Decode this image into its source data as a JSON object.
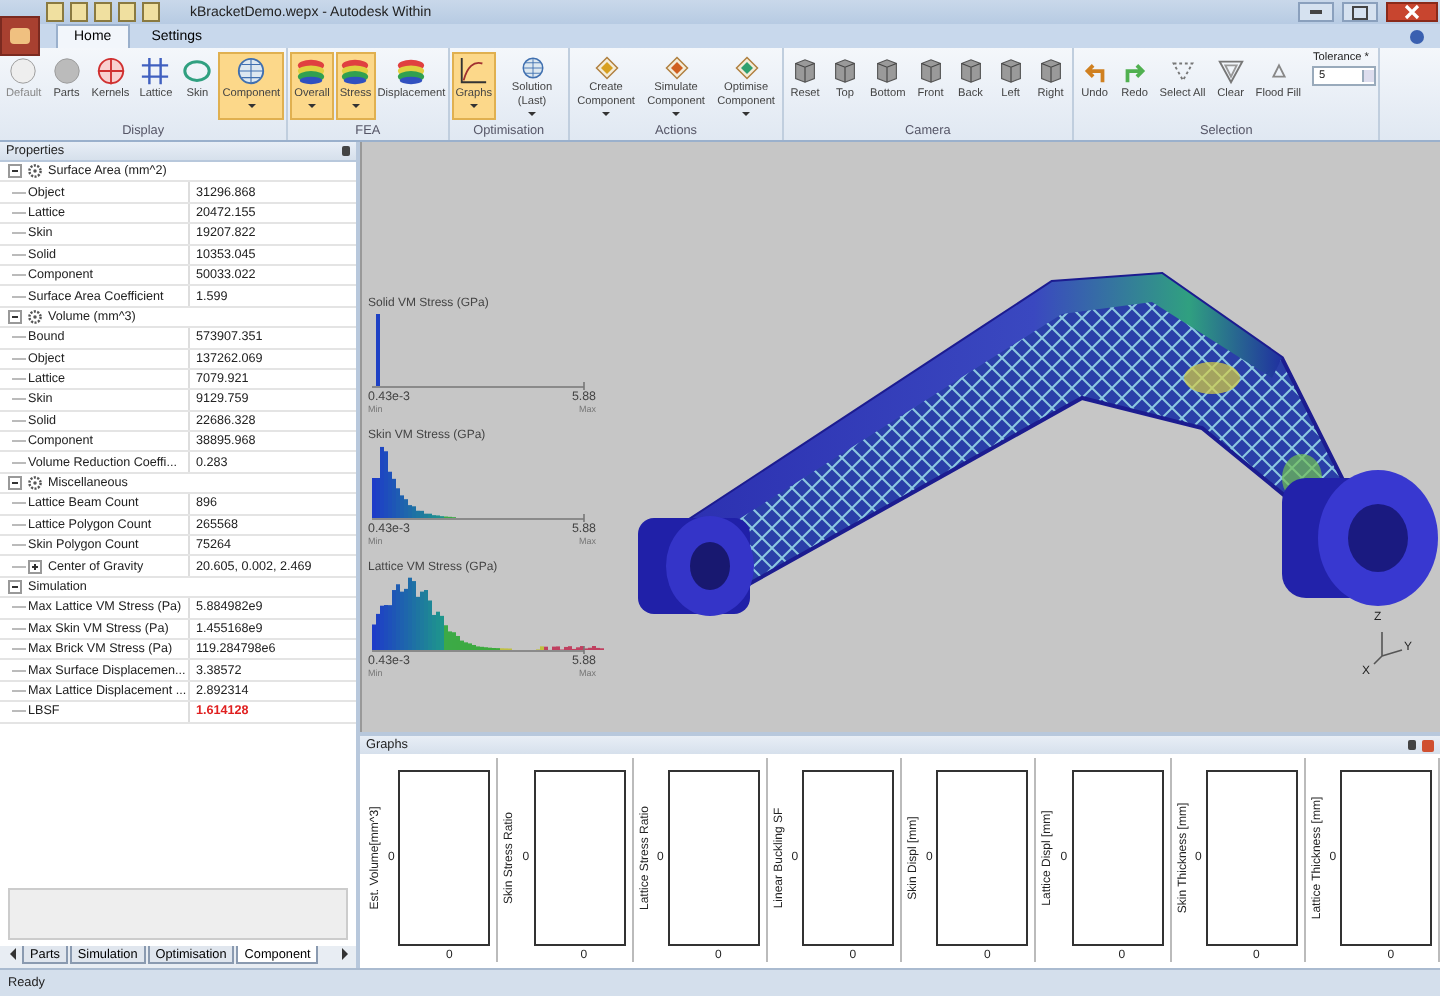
{
  "window": {
    "title": "kBracketDemo.wepx - Autodesk Within"
  },
  "tabs": [
    {
      "label": "Home",
      "selected": true
    },
    {
      "label": "Settings",
      "selected": false
    }
  ],
  "ribbon": {
    "groups": [
      {
        "label": "Display",
        "buttons": [
          {
            "label": "Default",
            "selected": false,
            "disabled": true,
            "dropdown": false
          },
          {
            "label": "Parts",
            "selected": false,
            "disabled": false,
            "dropdown": false
          },
          {
            "label": "Kernels",
            "selected": false,
            "disabled": false,
            "dropdown": false
          },
          {
            "label": "Lattice",
            "selected": false,
            "disabled": false,
            "dropdown": false
          },
          {
            "label": "Skin",
            "selected": false,
            "disabled": false,
            "dropdown": false
          },
          {
            "label": "Component",
            "selected": true,
            "disabled": false,
            "dropdown": true
          }
        ]
      },
      {
        "label": "FEA",
        "buttons": [
          {
            "label": "Overall",
            "selected": true,
            "disabled": false,
            "dropdown": true
          },
          {
            "label": "Stress",
            "selected": true,
            "disabled": false,
            "dropdown": true
          },
          {
            "label": "Displacement",
            "selected": false,
            "disabled": false,
            "dropdown": false
          }
        ]
      },
      {
        "label": "Optimisation",
        "buttons": [
          {
            "label": "Graphs",
            "selected": true,
            "disabled": false,
            "dropdown": true
          },
          {
            "label": "Solution (Last)",
            "selected": false,
            "disabled": false,
            "dropdown": true
          }
        ]
      },
      {
        "label": "Actions",
        "buttons": [
          {
            "label": "Create Component",
            "selected": false,
            "disabled": false,
            "dropdown": true
          },
          {
            "label": "Simulate Component",
            "selected": false,
            "disabled": false,
            "dropdown": true
          },
          {
            "label": "Optimise Component",
            "selected": false,
            "disabled": false,
            "dropdown": true
          }
        ]
      },
      {
        "label": "Camera",
        "buttons": [
          {
            "label": "Reset",
            "selected": false,
            "disabled": false,
            "dropdown": false
          },
          {
            "label": "Top",
            "selected": false,
            "disabled": false,
            "dropdown": false
          },
          {
            "label": "Bottom",
            "selected": false,
            "disabled": false,
            "dropdown": false
          },
          {
            "label": "Front",
            "selected": false,
            "disabled": false,
            "dropdown": false
          },
          {
            "label": "Back",
            "selected": false,
            "disabled": false,
            "dropdown": false
          },
          {
            "label": "Left",
            "selected": false,
            "disabled": false,
            "dropdown": false
          },
          {
            "label": "Right",
            "selected": false,
            "disabled": false,
            "dropdown": false
          }
        ]
      },
      {
        "label": "Selection",
        "buttons": [
          {
            "label": "Undo",
            "selected": false,
            "disabled": false,
            "dropdown": false
          },
          {
            "label": "Redo",
            "selected": false,
            "disabled": false,
            "dropdown": false
          },
          {
            "label": "Select All",
            "selected": false,
            "disabled": false,
            "dropdown": false
          },
          {
            "label": "Clear",
            "selected": false,
            "disabled": false,
            "dropdown": false
          },
          {
            "label": "Flood Fill",
            "selected": false,
            "disabled": false,
            "dropdown": false
          }
        ],
        "field": {
          "label": "Tolerance *",
          "value": "5"
        }
      }
    ]
  },
  "properties": {
    "title": "Properties",
    "groups": [
      {
        "label": "Surface Area (mm^2)",
        "kind": "gear",
        "expanded": true,
        "rows": [
          {
            "name": "Object",
            "value": "31296.868",
            "collapsed": false,
            "warning": false
          },
          {
            "name": "Lattice",
            "value": "20472.155",
            "collapsed": false,
            "warning": false
          },
          {
            "name": "Skin",
            "value": "19207.822",
            "collapsed": false,
            "warning": false
          },
          {
            "name": "Solid",
            "value": "10353.045",
            "collapsed": false,
            "warning": false
          },
          {
            "name": "Component",
            "value": "50033.022",
            "collapsed": false,
            "warning": false
          },
          {
            "name": "Surface Area Coefficient",
            "value": "1.599",
            "collapsed": false,
            "warning": false
          }
        ]
      },
      {
        "label": "Volume (mm^3)",
        "kind": "gear",
        "expanded": true,
        "rows": [
          {
            "name": "Bound",
            "value": "573907.351",
            "collapsed": false,
            "warning": false
          },
          {
            "name": "Object",
            "value": "137262.069",
            "collapsed": false,
            "warning": false
          },
          {
            "name": "Lattice",
            "value": "7079.921",
            "collapsed": false,
            "warning": false
          },
          {
            "name": "Skin",
            "value": "9129.759",
            "collapsed": false,
            "warning": false
          },
          {
            "name": "Solid",
            "value": "22686.328",
            "collapsed": false,
            "warning": false
          },
          {
            "name": "Component",
            "value": "38895.968",
            "collapsed": false,
            "warning": false
          },
          {
            "name": "Volume Reduction Coeffi...",
            "value": "0.283",
            "collapsed": false,
            "warning": false
          }
        ]
      },
      {
        "label": "Miscellaneous",
        "kind": "gear",
        "expanded": true,
        "rows": [
          {
            "name": "Lattice Beam Count",
            "value": "896",
            "collapsed": false,
            "warning": false
          },
          {
            "name": "Lattice Polygon Count",
            "value": "265568",
            "collapsed": false,
            "warning": false
          },
          {
            "name": "Skin Polygon Count",
            "value": "75264",
            "collapsed": false,
            "warning": false
          },
          {
            "name": "Center of Gravity",
            "value": "20.605, 0.002, 2.469",
            "collapsed": true,
            "warning": false
          }
        ]
      },
      {
        "label": "Simulation",
        "kind": "plain",
        "expanded": true,
        "rows": [
          {
            "name": "Max Lattice VM Stress (Pa)",
            "value": "5.884982e9",
            "collapsed": false,
            "warning": false
          },
          {
            "name": "Max Skin VM Stress (Pa)",
            "value": "1.455168e9",
            "collapsed": false,
            "warning": false
          },
          {
            "name": "Max Brick VM Stress (Pa)",
            "value": "119.284798e6",
            "collapsed": false,
            "warning": false
          },
          {
            "name": "Max Surface Displacemen...",
            "value": "3.38572",
            "collapsed": false,
            "warning": false
          },
          {
            "name": "Max Lattice Displacement ...",
            "value": "2.892314",
            "collapsed": false,
            "warning": false
          },
          {
            "name": "LBSF",
            "value": "1.614128",
            "collapsed": false,
            "warning": true
          }
        ]
      }
    ]
  },
  "panel_tabs": [
    {
      "label": "Parts",
      "selected": false
    },
    {
      "label": "Simulation",
      "selected": false
    },
    {
      "label": "Optimisation",
      "selected": false
    },
    {
      "label": "Component",
      "selected": true
    }
  ],
  "histograms": [
    {
      "title": "Solid VM Stress (GPa)",
      "min": "0.43e-3",
      "min_label": "Min",
      "max": "5.88",
      "max_label": "Max"
    },
    {
      "title": "Skin VM Stress (GPa)",
      "min": "0.43e-3",
      "min_label": "Min",
      "max": "5.88",
      "max_label": "Max"
    },
    {
      "title": "Lattice VM Stress (GPa)",
      "min": "0.43e-3",
      "min_label": "Min",
      "max": "5.88",
      "max_label": "Max"
    }
  ],
  "axes": {
    "x": "X",
    "y": "Y",
    "z": "Z"
  },
  "graphs": {
    "title": "Graphs",
    "charts": [
      {
        "ylabel": "Est. Volume[mm^3]",
        "y_value": "0",
        "x_value": "0"
      },
      {
        "ylabel": "Skin Stress Ratio",
        "y_value": "0",
        "x_value": "0"
      },
      {
        "ylabel": "Lattice Stress Ratio",
        "y_value": "0",
        "x_value": "0"
      },
      {
        "ylabel": "Linear Buckling SF",
        "y_value": "0",
        "x_value": "0"
      },
      {
        "ylabel": "Skin Displ [mm]",
        "y_value": "0",
        "x_value": "0"
      },
      {
        "ylabel": "Lattice Displ [mm]",
        "y_value": "0",
        "x_value": "0"
      },
      {
        "ylabel": "Skin Thickness [mm]",
        "y_value": "0",
        "x_value": "0"
      },
      {
        "ylabel": "Lattice Thickness [mm]",
        "y_value": "0",
        "x_value": "0"
      }
    ]
  },
  "status_bar": "Ready"
}
